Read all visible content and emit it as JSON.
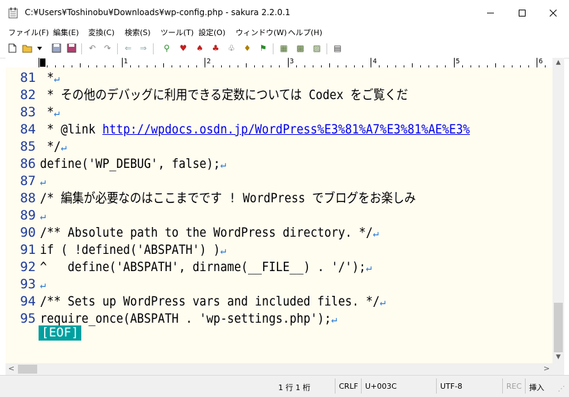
{
  "window": {
    "title": "C:¥Users¥Toshinobu¥Downloads¥wp-config.php - sakura 2.2.0.1",
    "minimize_icon": "minimize-icon",
    "maximize_icon": "maximize-icon",
    "close_icon": "close-icon"
  },
  "menu": [
    "ファイル(F)",
    "編集(E)",
    "変換(C)",
    "検索(S)",
    "ツール(T)",
    "設定(O)",
    "ウィンドウ(W)",
    "ヘルプ(H)"
  ],
  "toolbar_icons": [
    "new-file-icon",
    "open-folder-icon",
    "dropdown-arrow-icon",
    "save-icon",
    "save-all-icon",
    "undo-icon",
    "redo-icon",
    "jump-back-icon",
    "jump-forward-icon",
    "search-icon",
    "search-prev-icon",
    "search-next-icon",
    "replace-icon",
    "grep-icon",
    "tag-jump-icon",
    "outline-icon",
    "compare-icon",
    "macro-icon",
    "window-list-icon"
  ],
  "ruler": {
    "labels": [
      "0",
      "1",
      "2",
      "3",
      "4",
      "5",
      "6"
    ]
  },
  "editor": {
    "line_numbers": [
      "81",
      "82",
      "83",
      "84",
      "85",
      "86",
      "87",
      "88",
      "89",
      "90",
      "91",
      "92",
      "93",
      "94",
      "95"
    ],
    "lines": [
      {
        "text": " *",
        "eol": "↵"
      },
      {
        "text": " * その他のデバッグに利用できる定数については Codex をご覧くだ",
        "eol": ""
      },
      {
        "text": " *",
        "eol": "↵"
      },
      {
        "text": " * @link ",
        "link": "http://wpdocs.osdn.jp/WordPress%E3%81%A7%E3%81%AE%E3%",
        "eol": ""
      },
      {
        "text": " */",
        "eol": "↵"
      },
      {
        "text": "define('WP_DEBUG', false);",
        "eol": "↵"
      },
      {
        "text": "",
        "eol": "↵"
      },
      {
        "text": "/* 編集が必要なのはここまでです ! WordPress でブログをお楽しみ",
        "eol": ""
      },
      {
        "text": "",
        "eol": "↵"
      },
      {
        "text": "/** Absolute path to the WordPress directory. */",
        "eol": "↵"
      },
      {
        "text": "if ( !defined('ABSPATH') )",
        "eol": "↵"
      },
      {
        "text": "^   define('ABSPATH', dirname(__FILE__) . '/');",
        "eol": "↵"
      },
      {
        "text": "",
        "eol": "↵"
      },
      {
        "text": "/** Sets up WordPress vars and included files. */",
        "eol": "↵"
      },
      {
        "text": "require_once(ABSPATH . 'wp-settings.php');",
        "eol": "↵"
      }
    ],
    "eof_marker": "[EOF]"
  },
  "scrollbar": {
    "up_arrow": "▲",
    "down_arrow": "▼",
    "left_arrow": "<",
    "right_arrow": ">"
  },
  "status": {
    "position": "1 行  1 桁",
    "line_ending": "CRLF",
    "char_code": "U+003C",
    "encoding": "UTF-8",
    "rec": "REC",
    "insert_mode": "挿入"
  }
}
